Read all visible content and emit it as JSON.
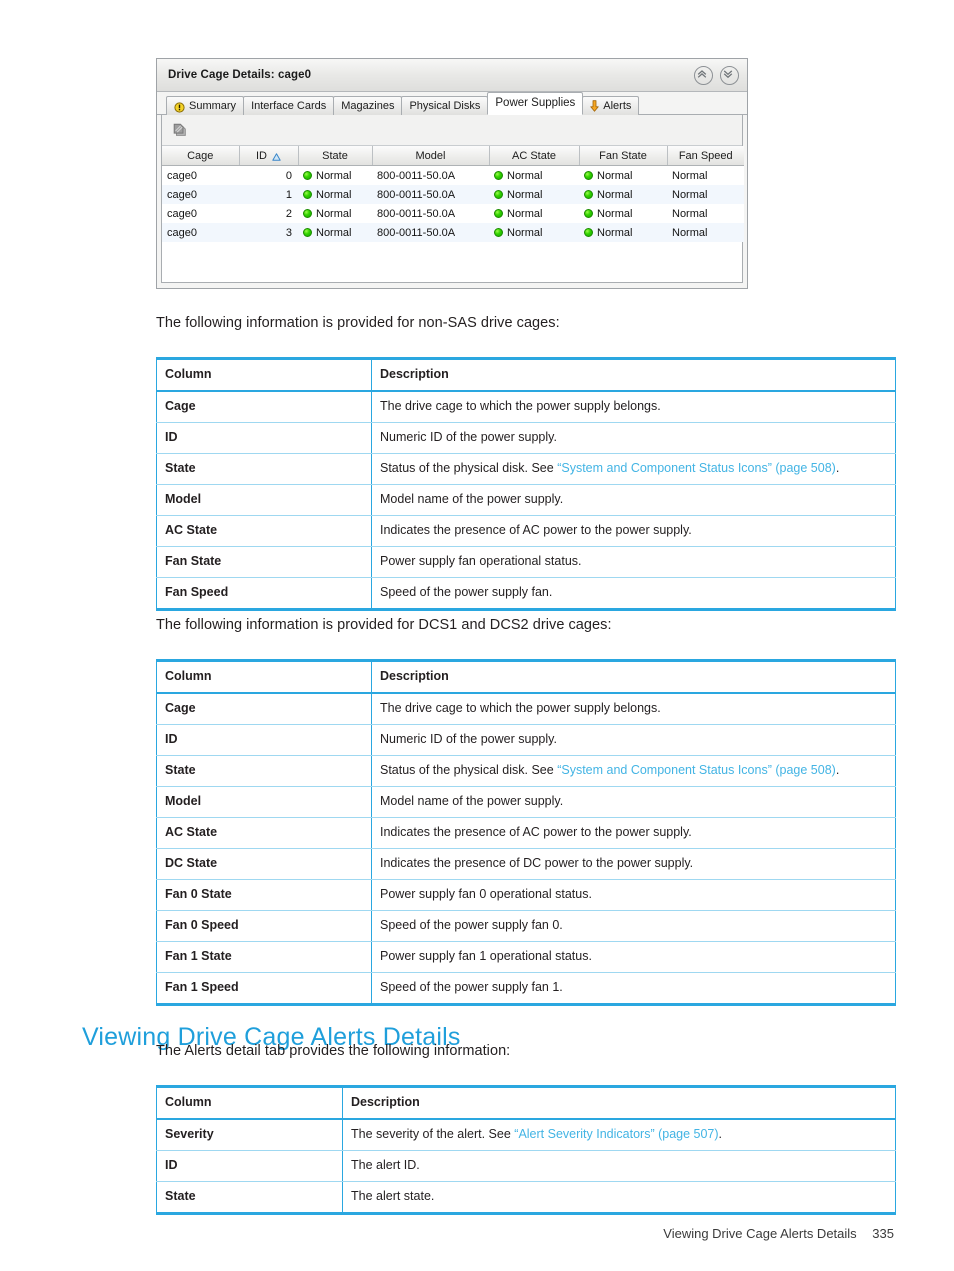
{
  "figure": {
    "title": "Drive Cage Details: cage0",
    "header_buttons": [
      {
        "name": "collapse-all-button",
        "icon": "chevron-double-up-icon"
      },
      {
        "name": "expand-all-button",
        "icon": "chevron-double-down-icon"
      }
    ],
    "tabs": [
      {
        "label": "Summary",
        "icon": "warning-icon",
        "active": false
      },
      {
        "label": "Interface Cards",
        "icon": "",
        "active": false
      },
      {
        "label": "Magazines",
        "icon": "",
        "active": false
      },
      {
        "label": "Physical Disks",
        "icon": "",
        "active": false
      },
      {
        "label": "Power Supplies",
        "icon": "",
        "active": true
      },
      {
        "label": "Alerts",
        "icon": "down-arrow-icon",
        "active": false
      }
    ],
    "toolbar": {
      "copy_icon": "copy-pages-icon"
    },
    "grid": {
      "columns": [
        "Cage",
        "ID",
        "State",
        "Model",
        "AC State",
        "Fan State",
        "Fan Speed"
      ],
      "sorted_column": "ID",
      "sort_direction": "ascending",
      "rows": [
        {
          "cage": "cage0",
          "id": "0",
          "state": "Normal",
          "model": "800-0011-50.0A",
          "ac_state": "Normal",
          "fan_state": "Normal",
          "fan_speed": "Normal"
        },
        {
          "cage": "cage0",
          "id": "1",
          "state": "Normal",
          "model": "800-0011-50.0A",
          "ac_state": "Normal",
          "fan_state": "Normal",
          "fan_speed": "Normal"
        },
        {
          "cage": "cage0",
          "id": "2",
          "state": "Normal",
          "model": "800-0011-50.0A",
          "ac_state": "Normal",
          "fan_state": "Normal",
          "fan_speed": "Normal"
        },
        {
          "cage": "cage0",
          "id": "3",
          "state": "Normal",
          "model": "800-0011-50.0A",
          "ac_state": "Normal",
          "fan_state": "Normal",
          "fan_speed": "Normal"
        }
      ]
    }
  },
  "intro1": "The following information is provided for non-SAS drive cages:",
  "table1": {
    "headers": [
      "Column",
      "Description"
    ],
    "rows": [
      {
        "column": "Cage",
        "desc_pre": "The drive cage to which the power supply belongs.",
        "link": "",
        "desc_post": ""
      },
      {
        "column": "ID",
        "desc_pre": "Numeric ID of the power supply.",
        "link": "",
        "desc_post": ""
      },
      {
        "column": "State",
        "desc_pre": "Status of the physical disk. See ",
        "link": "“System and Component Status Icons” (page 508)",
        "desc_post": "."
      },
      {
        "column": "Model",
        "desc_pre": "Model name of the power supply.",
        "link": "",
        "desc_post": ""
      },
      {
        "column": "AC State",
        "desc_pre": "Indicates the presence of AC power to the power supply.",
        "link": "",
        "desc_post": ""
      },
      {
        "column": "Fan State",
        "desc_pre": "Power supply fan operational status.",
        "link": "",
        "desc_post": ""
      },
      {
        "column": "Fan Speed",
        "desc_pre": "Speed of the power supply fan.",
        "link": "",
        "desc_post": ""
      }
    ]
  },
  "intro2": "The following information is provided for DCS1 and DCS2 drive cages:",
  "table2": {
    "headers": [
      "Column",
      "Description"
    ],
    "rows": [
      {
        "column": "Cage",
        "desc_pre": "The drive cage to which the power supply belongs.",
        "link": "",
        "desc_post": ""
      },
      {
        "column": "ID",
        "desc_pre": "Numeric ID of the power supply.",
        "link": "",
        "desc_post": ""
      },
      {
        "column": "State",
        "desc_pre": "Status of the physical disk. See ",
        "link": "“System and Component Status Icons” (page 508)",
        "desc_post": "."
      },
      {
        "column": "Model",
        "desc_pre": "Model name of the power supply.",
        "link": "",
        "desc_post": ""
      },
      {
        "column": "AC State",
        "desc_pre": "Indicates the presence of AC power to the power supply.",
        "link": "",
        "desc_post": ""
      },
      {
        "column": "DC State",
        "desc_pre": "Indicates the presence of DC power to the power supply.",
        "link": "",
        "desc_post": ""
      },
      {
        "column": "Fan 0 State",
        "desc_pre": "Power supply fan 0 operational status.",
        "link": "",
        "desc_post": ""
      },
      {
        "column": "Fan 0 Speed",
        "desc_pre": "Speed of the power supply fan 0.",
        "link": "",
        "desc_post": ""
      },
      {
        "column": "Fan 1 State",
        "desc_pre": "Power supply fan 1 operational status.",
        "link": "",
        "desc_post": ""
      },
      {
        "column": "Fan 1 Speed",
        "desc_pre": "Speed of the power supply fan 1.",
        "link": "",
        "desc_post": ""
      }
    ]
  },
  "heading": "Viewing Drive Cage Alerts Details",
  "intro3": "The Alerts detail tab provides the following information:",
  "table3": {
    "headers": [
      "Column",
      "Description"
    ],
    "rows": [
      {
        "column": "Severity",
        "desc_pre": "The severity of the alert. See ",
        "link": "“Alert Severity Indicators” (page 507)",
        "desc_post": "."
      },
      {
        "column": "ID",
        "desc_pre": "The alert ID.",
        "link": "",
        "desc_post": ""
      },
      {
        "column": "State",
        "desc_pre": "The alert state.",
        "link": "",
        "desc_post": ""
      }
    ]
  },
  "footer": {
    "section": "Viewing Drive Cage Alerts Details",
    "page": "335"
  },
  "colors": {
    "table_border": "#2aa7e0",
    "row_divider": "#9fd8f1",
    "link": "#43b4e4",
    "heading": "#1f9fdb",
    "status_ok": "#2fd000"
  }
}
